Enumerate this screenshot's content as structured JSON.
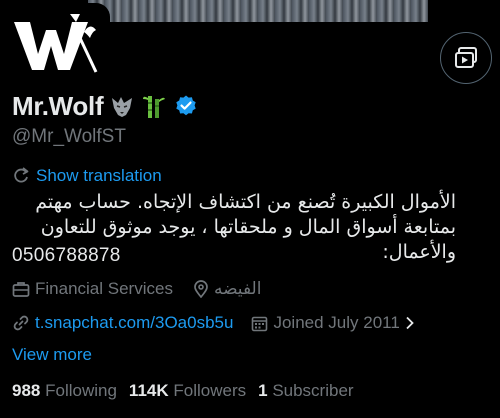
{
  "profile": {
    "display_name": "Mr.Wolf",
    "handle": "@Mr_WolfST",
    "emojis": [
      "wolf-emoji",
      "bamboo-emoji"
    ],
    "verified": true,
    "avatar_logo": "W"
  },
  "translate": {
    "label": "Show translation"
  },
  "bio": {
    "text": "الأموال الكبيرة تُصنع من اكتشاف الإتجاه. حساب مهتم بمتابعة أسواق المال و ملحقاتها ، يوجد موثوق للتعاون والأعمال:",
    "phone": "0506788878"
  },
  "meta": {
    "category": "Financial Services",
    "location": "الفيضه",
    "link": "t.snapchat.com/3Oa0sb5u",
    "joined": "Joined July 2011"
  },
  "view_more": "View more",
  "stats": {
    "following_count": "988",
    "following_label": "Following",
    "followers_count": "114K",
    "followers_label": "Followers",
    "subscribers_count": "1",
    "subscribers_label": "Subscriber"
  },
  "colors": {
    "background": "#000000",
    "text": "#e7e9ea",
    "muted": "#71767b",
    "accent": "#1d9bf0",
    "verified": "#1d9bf0"
  }
}
